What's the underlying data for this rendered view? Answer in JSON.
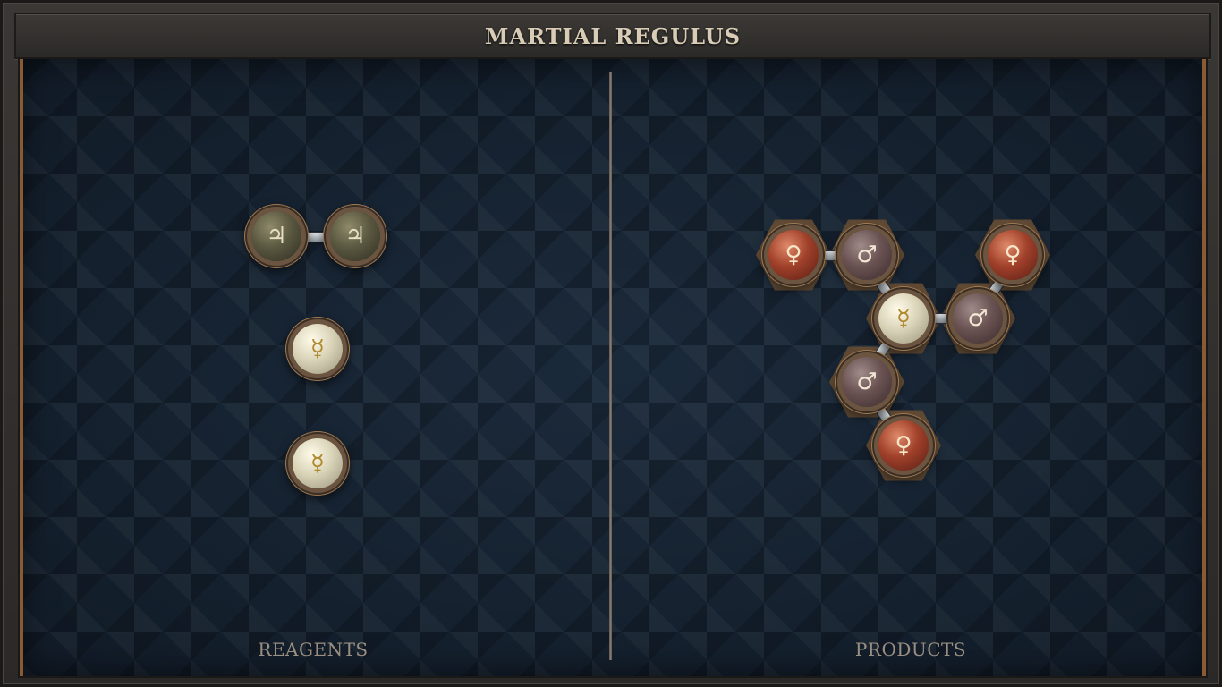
{
  "title": "MARTIAL REGULUS",
  "sections": {
    "reagents_label": "REAGENTS",
    "products_label": "PRODUCTS"
  },
  "reagents": [
    {
      "molecule": "lead-pair",
      "atoms": [
        "lead",
        "lead"
      ],
      "symbols": [
        "♃",
        "♃"
      ]
    },
    {
      "molecule": "quicksilver-1",
      "atoms": [
        "quicksilver"
      ],
      "symbols": [
        "☿"
      ]
    },
    {
      "molecule": "quicksilver-2",
      "atoms": [
        "quicksilver"
      ],
      "symbols": [
        "☿"
      ]
    }
  ],
  "product": {
    "atoms": [
      {
        "id": "copper-a",
        "element": "copper",
        "symbol": "♀"
      },
      {
        "id": "iron-a",
        "element": "iron",
        "symbol": "♂"
      },
      {
        "id": "copper-b",
        "element": "copper",
        "symbol": "♀"
      },
      {
        "id": "quicksilver-center",
        "element": "quicksilver",
        "symbol": "☿"
      },
      {
        "id": "iron-b",
        "element": "iron",
        "symbol": "♂"
      },
      {
        "id": "iron-c",
        "element": "iron",
        "symbol": "♂"
      },
      {
        "id": "copper-c",
        "element": "copper",
        "symbol": "♀"
      }
    ]
  },
  "colors": {
    "frame_accent": "#8a5a34",
    "board_background": "#152130",
    "label_text": "#9a8f82",
    "title_text": "#d9ccb6"
  }
}
